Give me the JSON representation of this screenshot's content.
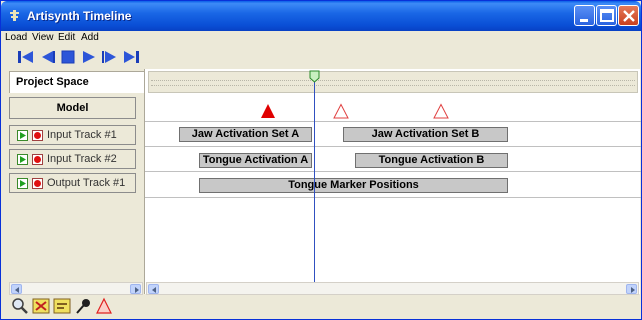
{
  "window": {
    "title": "Artisynth Timeline"
  },
  "menu": {
    "items": [
      "Load",
      "View",
      "Edit",
      "Add"
    ]
  },
  "toolbar": {
    "buttons": [
      "rewind-icon",
      "step-back-icon",
      "stop-icon",
      "play-icon",
      "step-forward-icon",
      "fast-forward-icon"
    ]
  },
  "left_panel": {
    "project_space": "Project Space",
    "model": "Model",
    "tracks": [
      "Input Track #1",
      "Input Track #2",
      "Output Track #1"
    ]
  },
  "timeline": {
    "markers": [
      {
        "style": "filled",
        "color": "#e00000"
      },
      {
        "style": "outline",
        "color": "#e00000"
      },
      {
        "style": "outline",
        "color": "#e00000"
      }
    ],
    "probes": {
      "row1": [
        "Jaw Activation Set A",
        "Jaw Activation Set B"
      ],
      "row2": [
        "Tongue Activation A",
        "Tongue Activation B"
      ],
      "row3": [
        "Tongue Marker Positions"
      ]
    }
  },
  "bottom_toolbar": {
    "buttons": [
      "magnifier-icon",
      "probe-edit-icon",
      "probe-add-icon",
      "pin-icon",
      "marker-add-icon"
    ]
  },
  "colors": {
    "titlebar": "#0a4fd6",
    "cursor": "#3050c0",
    "marker": "#e00000",
    "probe": "#c8c8c8"
  }
}
